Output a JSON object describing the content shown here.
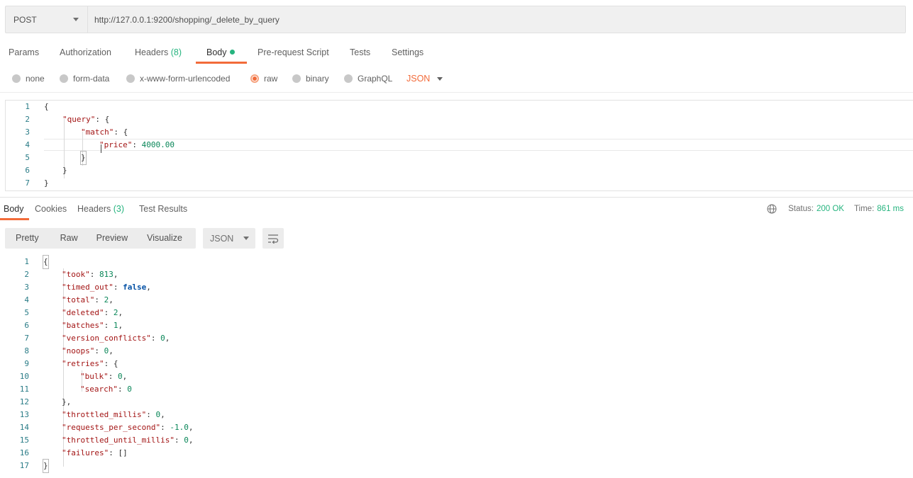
{
  "request": {
    "method": "POST",
    "url": "http://127.0.0.1:9200/shopping/_delete_by_query"
  },
  "request_tabs": {
    "params": "Params",
    "authorization": "Authorization",
    "headers": "Headers",
    "headers_count": "(8)",
    "body": "Body",
    "pre_request": "Pre-request Script",
    "tests": "Tests",
    "settings": "Settings"
  },
  "body_types": {
    "none": "none",
    "form_data": "form-data",
    "urlencoded": "x-www-form-urlencoded",
    "raw": "raw",
    "binary": "binary",
    "graphql": "GraphQL",
    "format": "JSON",
    "selected": "raw"
  },
  "request_body": [
    {
      "n": "1",
      "text": "{"
    },
    {
      "n": "2",
      "text": "\"query\": {"
    },
    {
      "n": "3",
      "text": "\"match\": {"
    },
    {
      "n": "4",
      "text": "\"price\": 4000.00"
    },
    {
      "n": "5",
      "text": "}"
    },
    {
      "n": "6",
      "text": "}"
    },
    {
      "n": "7",
      "text": "}"
    }
  ],
  "response_tabs": {
    "body": "Body",
    "cookies": "Cookies",
    "headers": "Headers",
    "headers_count": "(3)",
    "test_results": "Test Results"
  },
  "response_status": {
    "status_label": "Status:",
    "status_value": "200 OK",
    "time_label": "Time:",
    "time_value": "861 ms"
  },
  "response_view": {
    "pretty": "Pretty",
    "raw": "Raw",
    "preview": "Preview",
    "visualize": "Visualize",
    "format": "JSON"
  },
  "response_body": [
    {
      "n": "1",
      "text": "{"
    },
    {
      "n": "2",
      "text": "\"took\": 813,"
    },
    {
      "n": "3",
      "text": "\"timed_out\": false,"
    },
    {
      "n": "4",
      "text": "\"total\": 2,"
    },
    {
      "n": "5",
      "text": "\"deleted\": 2,"
    },
    {
      "n": "6",
      "text": "\"batches\": 1,"
    },
    {
      "n": "7",
      "text": "\"version_conflicts\": 0,"
    },
    {
      "n": "8",
      "text": "\"noops\": 0,"
    },
    {
      "n": "9",
      "text": "\"retries\": {"
    },
    {
      "n": "10",
      "text": "\"bulk\": 0,"
    },
    {
      "n": "11",
      "text": "\"search\": 0"
    },
    {
      "n": "12",
      "text": "},"
    },
    {
      "n": "13",
      "text": "\"throttled_millis\": 0,"
    },
    {
      "n": "14",
      "text": "\"requests_per_second\": -1.0,"
    },
    {
      "n": "15",
      "text": "\"throttled_until_millis\": 0,"
    },
    {
      "n": "16",
      "text": "\"failures\": []"
    },
    {
      "n": "17",
      "text": "}"
    }
  ],
  "colors": {
    "accent": "#f26b3a",
    "success": "#26b47f",
    "json_key": "#a31515",
    "json_number": "#098658",
    "json_bool": "#0451a5",
    "line_number": "#2a7c87"
  }
}
